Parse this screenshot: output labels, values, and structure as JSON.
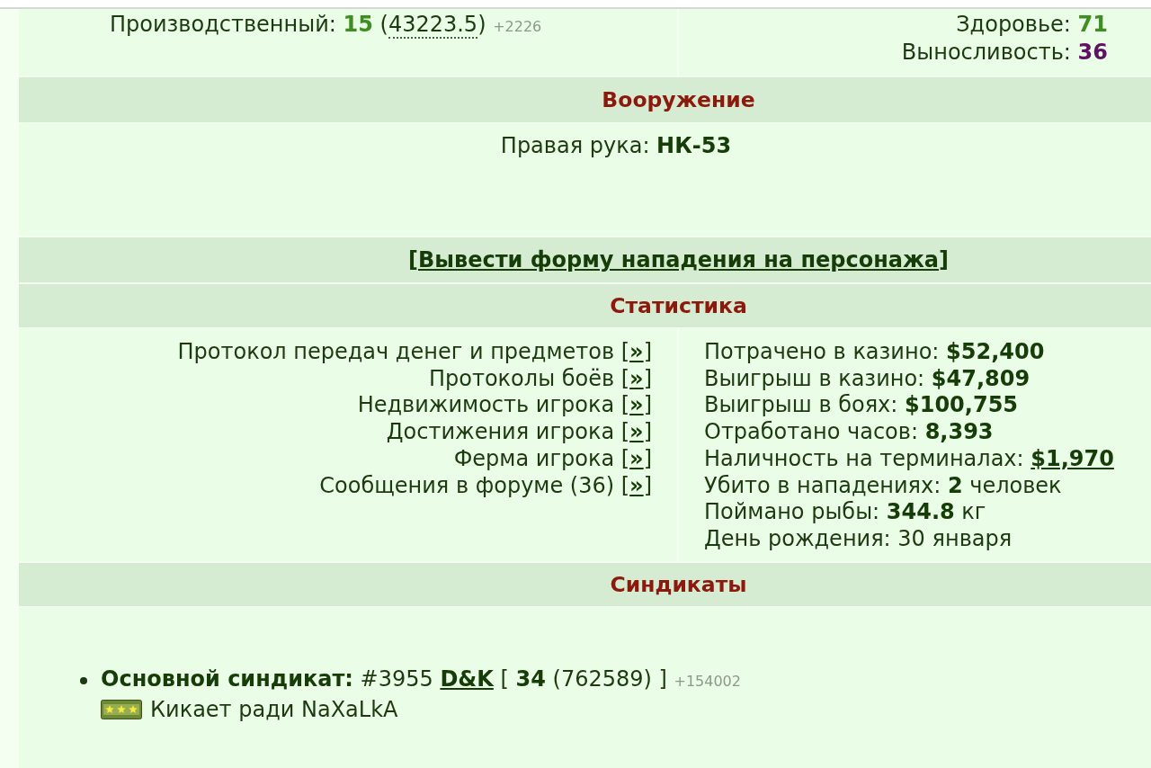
{
  "skill": {
    "label": "Производственный:",
    "value": "15",
    "open": "(",
    "experience": "43223.5",
    "close": ")",
    "gain": "+2226"
  },
  "vitals": [
    {
      "label": "Здоровье:",
      "value": "71",
      "color": "#3f8e22"
    },
    {
      "label": "Выносливость:",
      "value": "36",
      "color": "#5e1261"
    }
  ],
  "armament": {
    "title": "Вооружение",
    "slots": [
      {
        "label": "Правая рука:",
        "item": "НК-53"
      }
    ]
  },
  "attack": {
    "open": "[",
    "link": "Вывести форму нападения на персонажа",
    "close": "]"
  },
  "statistics": {
    "title": "Статистика",
    "links": [
      {
        "label": "Протокол передач денег и предметов",
        "open": "[",
        "link": "»",
        "close": "]"
      },
      {
        "label": "Протоколы боёв",
        "open": "[",
        "link": "»",
        "close": "]"
      },
      {
        "label": "Недвижимость игрока",
        "open": "[",
        "link": "»",
        "close": "]"
      },
      {
        "label": "Достижения игрока",
        "open": "[",
        "link": "»",
        "close": "]"
      },
      {
        "label": "Ферма игрока",
        "open": "[",
        "link": "»",
        "close": "]"
      },
      {
        "label": "Сообщения в форуме (36)",
        "open": "[",
        "link": "»",
        "close": "]"
      }
    ],
    "facts": [
      {
        "label": "Потрачено в казино:",
        "value": "$52,400",
        "kind": "bold"
      },
      {
        "label": "Выигрыш в казино:",
        "value": "$47,809",
        "kind": "bold"
      },
      {
        "label": "Выигрыш в боях:",
        "value": "$100,755",
        "kind": "bold"
      },
      {
        "label": "Отработано часов:",
        "value": "8,393",
        "kind": "bold"
      },
      {
        "label": "Наличность на терминалах:",
        "value": "$1,970",
        "kind": "link"
      },
      {
        "label": "Убито в нападениях:",
        "value": "2",
        "unit": "человек",
        "kind": "bold"
      },
      {
        "label": "Поймано рыбы:",
        "value": "344.8",
        "unit": "кг",
        "kind": "bold"
      },
      {
        "label": "День рождения:",
        "value": "30 января",
        "kind": "plain"
      }
    ]
  },
  "syndicates": {
    "title": "Синдикаты",
    "items": [
      {
        "label": "Основной синдикат:",
        "number": "#3955",
        "name": "D&K",
        "open": "[",
        "rank": "34",
        "points": "(762589)",
        "close": "]",
        "gain": "+154002",
        "status": "Кикает ради NaXaLkA"
      }
    ]
  }
}
